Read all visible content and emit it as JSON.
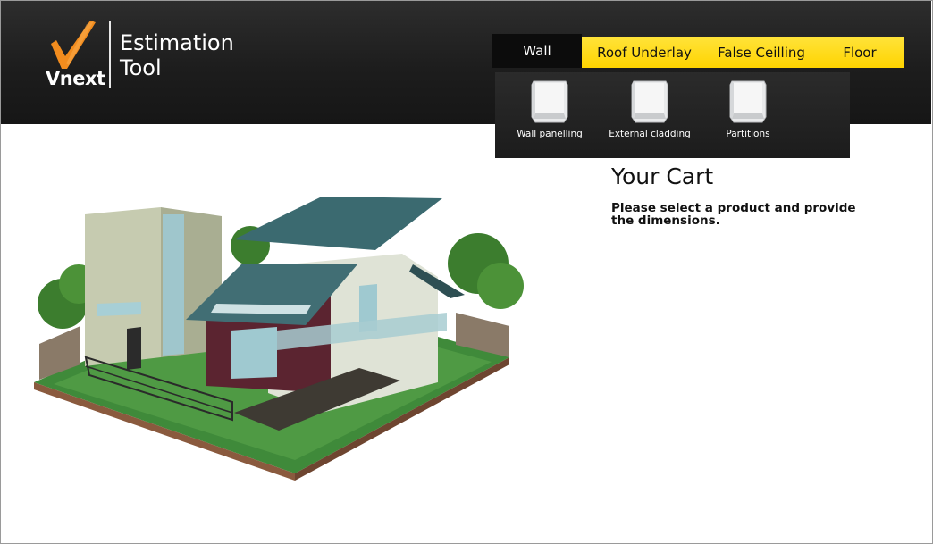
{
  "app": {
    "logo_text": "Vnext",
    "title_line1": "Estimation",
    "title_line2": "Tool"
  },
  "nav": {
    "items": [
      {
        "label": "Wall",
        "active": true
      },
      {
        "label": "Roof Underlay",
        "active": false
      },
      {
        "label": "False Ceilling",
        "active": false
      },
      {
        "label": "Floor",
        "active": false
      }
    ]
  },
  "dropdown": {
    "items": [
      {
        "label": "Wall panelling",
        "icon": "wall-panel-icon"
      },
      {
        "label": "External cladding",
        "icon": "cladding-panel-icon"
      },
      {
        "label": "Partitions",
        "icon": "partition-panel-icon"
      }
    ]
  },
  "cart": {
    "title": "Your Cart",
    "message": "Please select a product and provide the dimensions."
  },
  "colors": {
    "header_dark": "#1d1d1d",
    "nav_yellow": "#ffd400",
    "nav_active_bg": "#0c0c0c"
  }
}
